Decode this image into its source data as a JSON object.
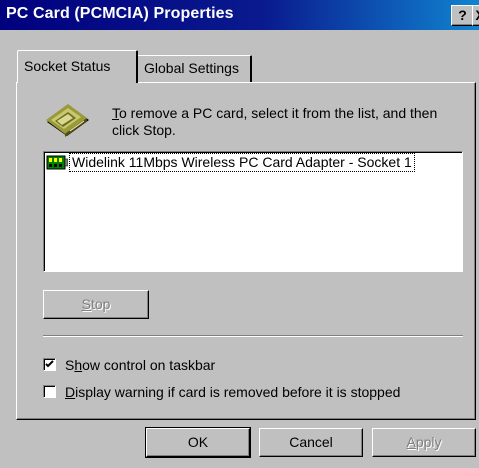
{
  "window": {
    "title": "PC Card (PCMCIA) Properties",
    "help_glyph": "?",
    "close_glyph": "X"
  },
  "tabs": [
    {
      "label": "Socket Status",
      "active": true
    },
    {
      "label": "Global Settings",
      "active": false
    }
  ],
  "instruction": {
    "mnemonic": "T",
    "rest": "o remove a PC card, select it from the list, and then click Stop."
  },
  "card_list": {
    "items": [
      "Widelink 11Mbps Wireless PC Card Adapter - Socket 1"
    ]
  },
  "stop_button": {
    "mnemonic": "S",
    "rest": "top",
    "enabled": false
  },
  "options": {
    "show_control": {
      "mnemonic": "h",
      "before": "S",
      "after": "ow control on taskbar",
      "checked": true
    },
    "display_warning": {
      "mnemonic": "D",
      "before": "",
      "after": "isplay warning if card is removed before it is stopped",
      "checked": false
    }
  },
  "buttons": {
    "ok": "OK",
    "cancel": "Cancel",
    "apply": {
      "mnemonic": "A",
      "rest": "pply",
      "enabled": false
    }
  },
  "colors": {
    "titlebar_start": "#00007e",
    "titlebar_end": "#1084d0",
    "face": "#c0c0c0"
  },
  "icons": {
    "card_icon": "pc-card-icon",
    "list_icon": "network-adapter-icon"
  }
}
